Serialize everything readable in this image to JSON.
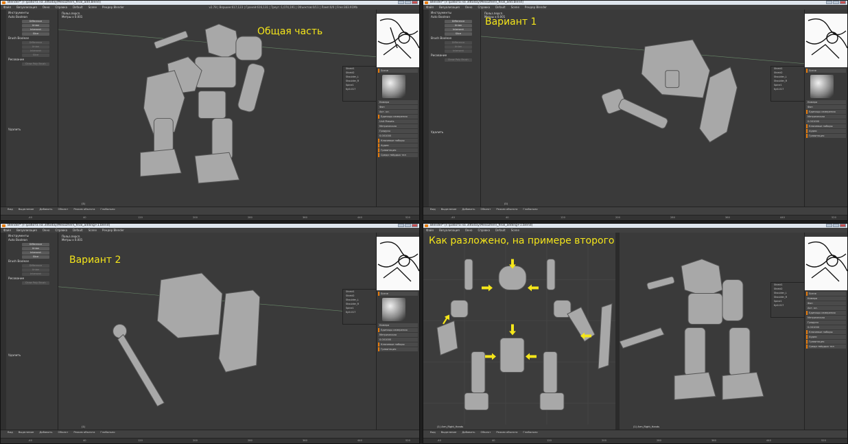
{
  "window_title": "Blender* [F:\\работа на 3dtoday\\Mesozhen\\_final_add.blend]",
  "app_title_short": "Blender* [F:\\работа на 3dtoday\\Mesozhen\\_final_adding+1.blend]",
  "menu": [
    "Файл",
    "Визуализация",
    "Окно",
    "Справка",
    "Default",
    "Scene",
    "Рендер Blender"
  ],
  "stats": "v2.78 | Вершин:617,123 | Граней:616,131 | Треуг.:1,074,191 | Объектов:0/11 | Ламп:0/0 | Free:383.91Mb",
  "left_panel": {
    "header": "Инструменты",
    "auto_boolean": "Auto Boolean",
    "buttons": [
      "Difference",
      "Union",
      "Intersect",
      "Slice"
    ],
    "brush_boolean": "Brush Boolean",
    "brush_buttons": [
      "Difference",
      "Union",
      "Intersect",
      "Slice",
      "Bool. to Mesh"
    ],
    "drawing": "Рисование",
    "draw_item": "Draw Poly Brush",
    "undo": "Удалить"
  },
  "viewport": {
    "view_label": "Польз.персп.",
    "units_label": "Метры x 0.001",
    "frame_label": "(1)",
    "frame_label_arm": "(1) Arm_Right_Hands"
  },
  "captions": {
    "q1": "Общая часть",
    "q2": "Вариант 1",
    "q3": "Вариант 2",
    "q4": "Как разложено, на примере второго варианта"
  },
  "right_panel": {
    "scene": "Scene",
    "rows": [
      "Камера",
      "Фон",
      "Акт. кл.",
      "Единицы измерения",
      "Unit Presets",
      "Length",
      "Метрическая",
      "Угол",
      "Градусы",
      "Unit Scale",
      "0.001000",
      "Ключевые наборы",
      "Аудио",
      "Гравитация",
      "Среда твёрдых тел"
    ],
    "material": "Material",
    "outliner": [
      "Shield1",
      "Shield2",
      "Shoulder_L",
      "Shoulder_R",
      "Spine1",
      "Kyili.017"
    ]
  },
  "bottom_header": [
    "Вид",
    "Выделение",
    "Добавить",
    "Объект",
    "Режим объекта",
    "Глобально",
    "Обзор"
  ],
  "ruler_ticks": [
    "-40",
    "-20",
    "0",
    "20",
    "40",
    "60",
    "80",
    "100",
    "120",
    "140",
    "160",
    "180",
    "200",
    "220",
    "240",
    "260",
    "280",
    "300",
    "320",
    "340",
    "360",
    "380",
    "400",
    "420",
    "440",
    "460",
    "480",
    "500",
    "520",
    "540",
    "560"
  ],
  "colors": {
    "accent": "#e87d0d",
    "caption": "#f5e61a",
    "arrow": "#f5e61a",
    "viewport": "#3a3a3a",
    "panel": "#393939"
  }
}
